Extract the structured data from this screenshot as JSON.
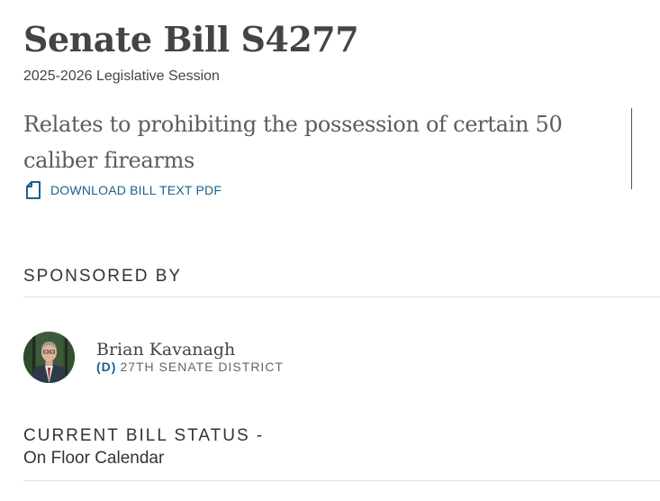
{
  "bill": {
    "title": "Senate Bill S4277",
    "session": "2025-2026 Legislative Session",
    "summary": "Relates to prohibiting the possession of certain 50 caliber firearms",
    "download_label": "DOWNLOAD BILL TEXT PDF",
    "download_icon": "document-icon"
  },
  "sponsors": {
    "heading": "SPONSORED BY",
    "items": [
      {
        "name": "Brian Kavanagh",
        "party": "(D)",
        "district": "27TH SENATE DISTRICT"
      }
    ]
  },
  "status": {
    "heading": "CURRENT BILL STATUS -",
    "value": "On Floor Calendar"
  },
  "colors": {
    "link_blue": "#1f5f8b",
    "heading_gray": "#444444",
    "divider": "#dddddd"
  }
}
